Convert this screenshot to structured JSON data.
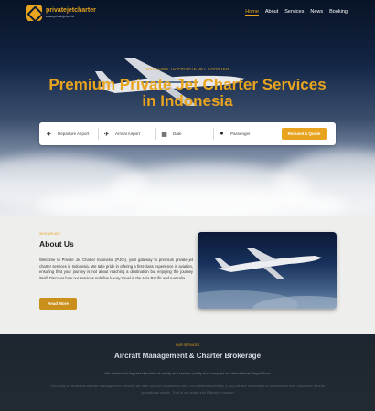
{
  "brand": {
    "name": "privatejetcharter",
    "tagline": "www.privatejet.co.id"
  },
  "nav": {
    "items": [
      {
        "label": "Home",
        "active": true
      },
      {
        "label": "About",
        "active": false
      },
      {
        "label": "Services",
        "active": false
      },
      {
        "label": "News",
        "active": false
      },
      {
        "label": "Booking",
        "active": false
      }
    ]
  },
  "hero": {
    "eyebrow": "WELCOME TO PRIVATE JET CHARTER",
    "title_line1": "Premium Private Jet Charter Services",
    "title_line2": "in Indonesia"
  },
  "booking": {
    "departure": "Departure Airport",
    "arrival": "Arrival Airport",
    "date": "Date",
    "passenger": "Passenger",
    "submit": "Request a Quote"
  },
  "about": {
    "eyebrow": "WHO WE ARE",
    "title": "About Us",
    "body": "Welcome to Private Jet Charter Indonesia (PJCI), your gateway to premium private jet charter services in Indonesia. We take pride in offering a first-class experience in aviation, ensuring that your journey is not about reaching a destination but enjoying the journey itself. Discover how our services redefine luxury travel in the Asia Pacific and Australia.",
    "button": "Read More"
  },
  "services": {
    "eyebrow": "OUR SERVICES",
    "title": "Aircraft Management & Charter Brokerage",
    "lead": "We deliver the highest standard of safety and service quality that complies to International Regulations",
    "body": "Focusing on Business Aircraft Management Service, we start out our business to the Civil Aviation Authority (CAA) we are committed to understand their corporate aircraft operational needs. That is we relate into Effective manner"
  },
  "colors": {
    "accent": "#e8a41e",
    "hero_sky": "#15284a",
    "about_bg": "#eeeeec",
    "services_bg": "#1d2630"
  }
}
